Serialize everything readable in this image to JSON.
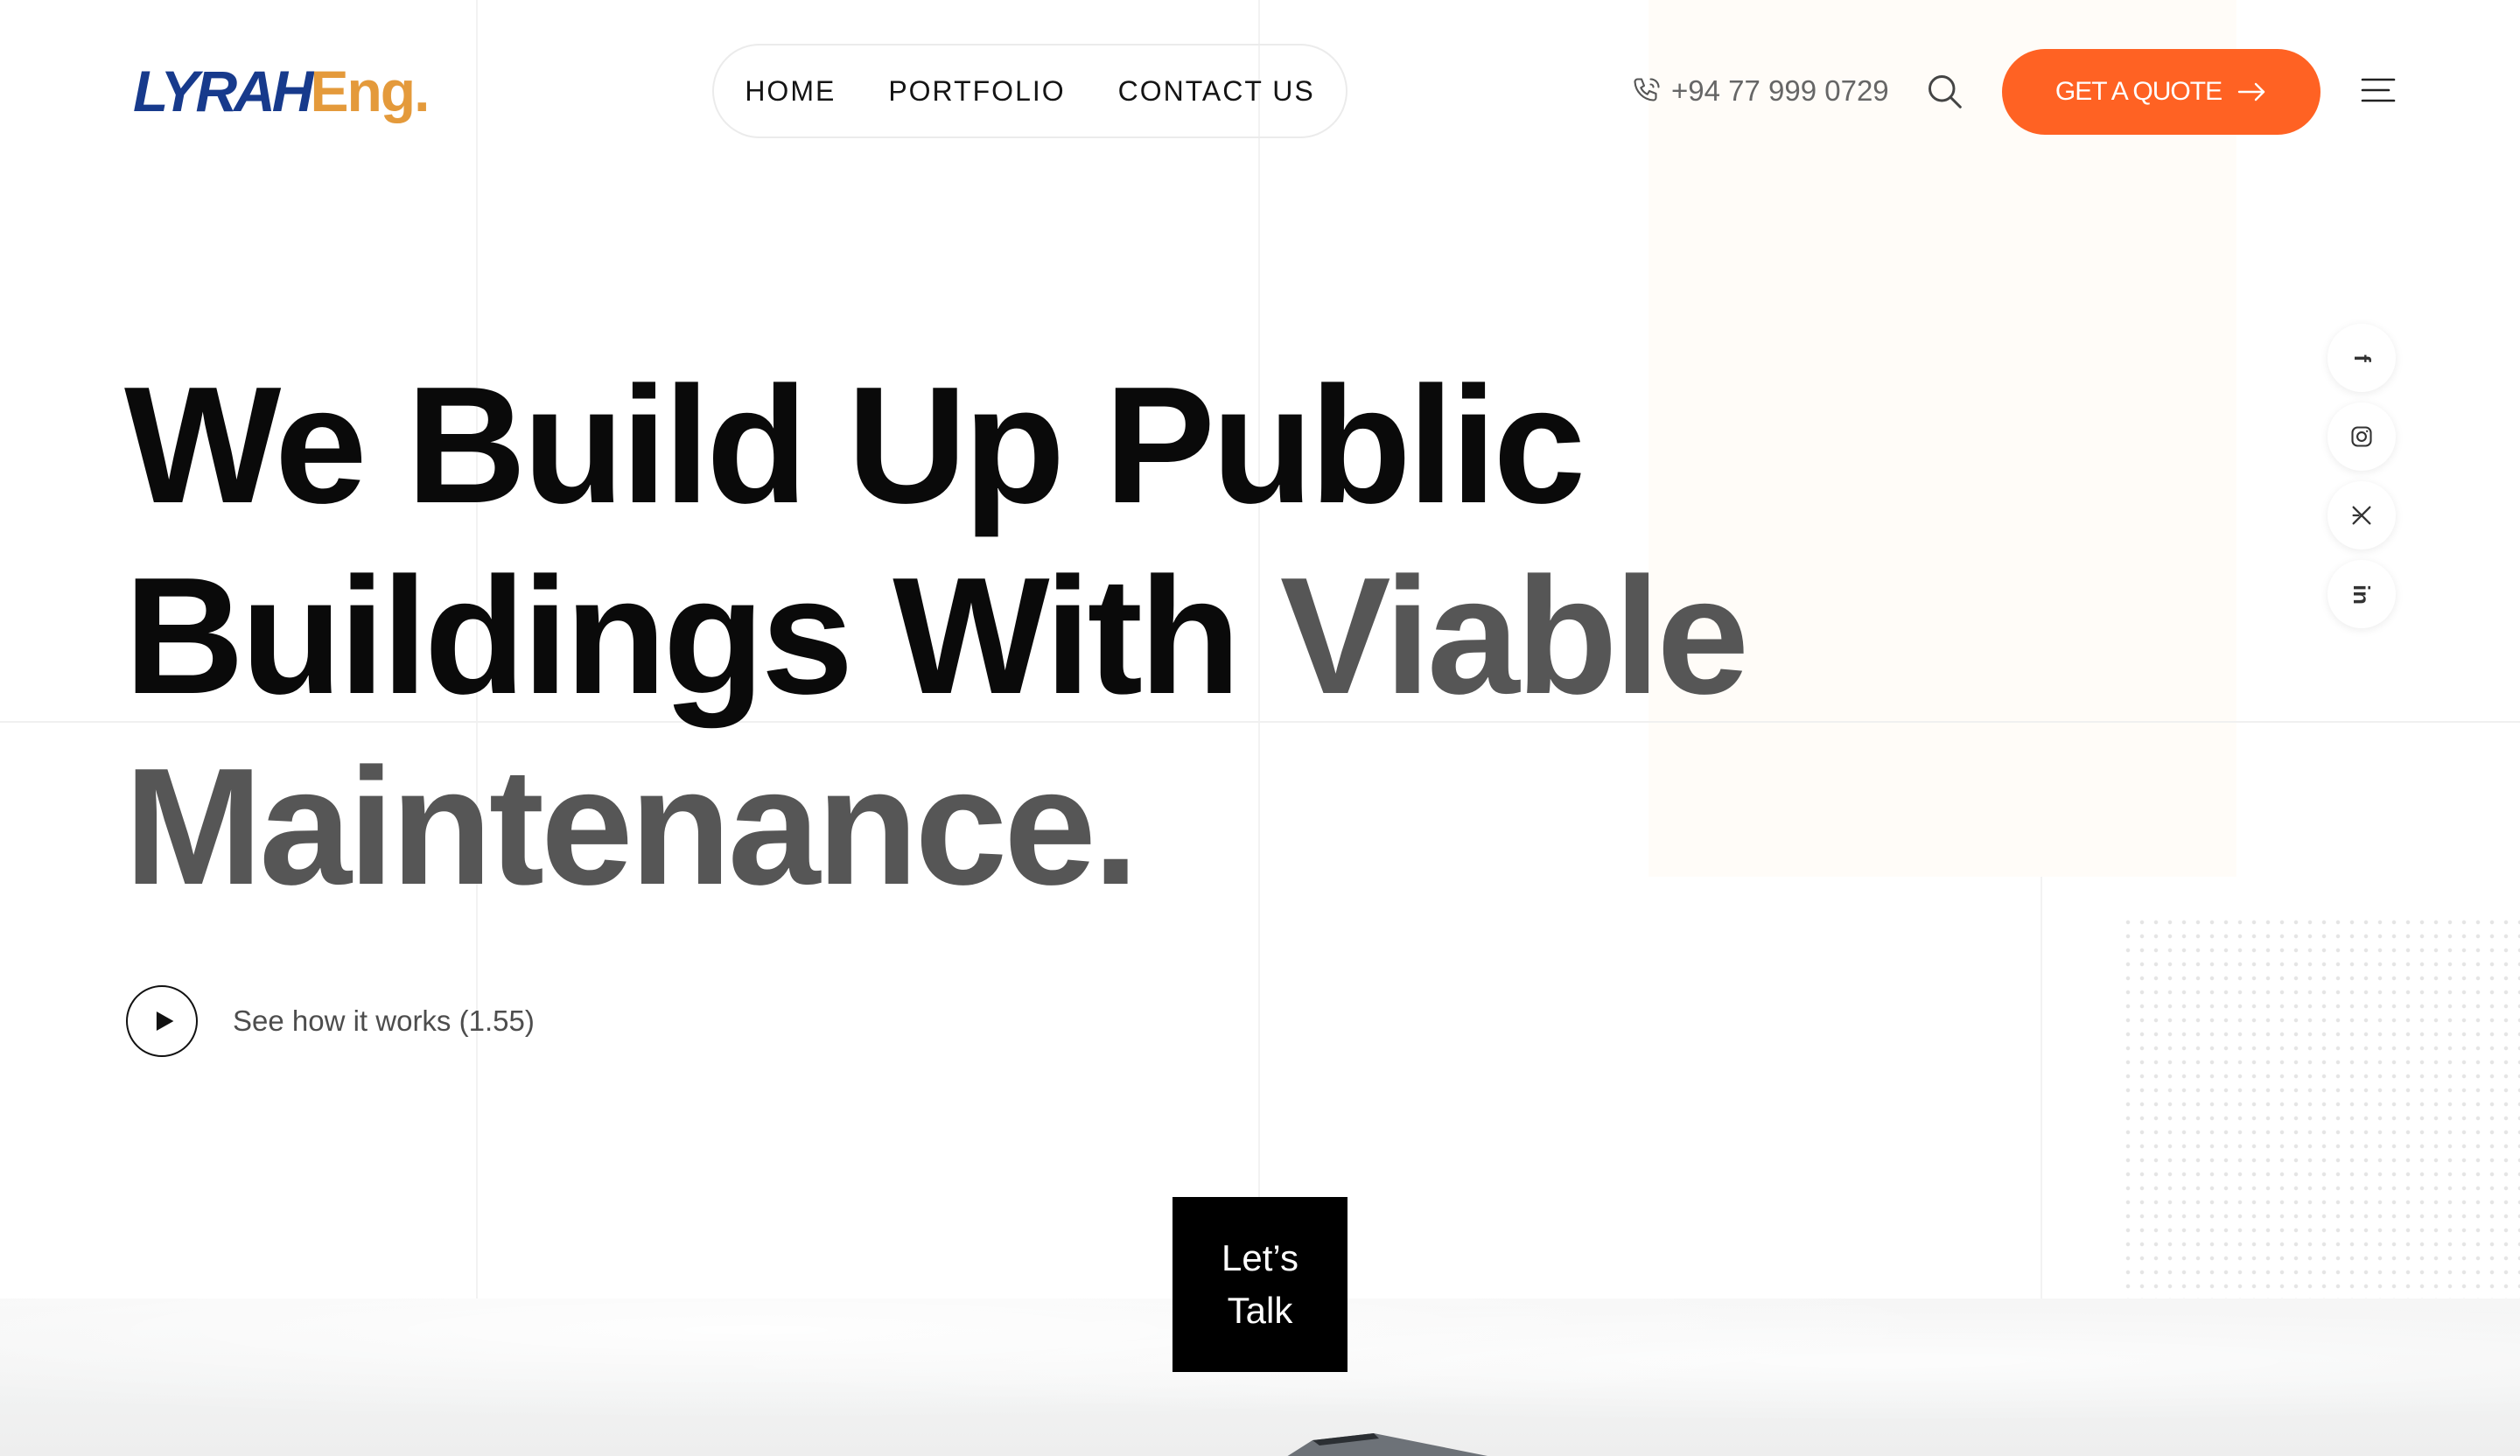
{
  "brand": {
    "logo_primary": "LYRAH",
    "logo_secondary": "Eng",
    "logo_dot": ".",
    "primary_color": "#173a8c",
    "secondary_color": "#e49a3b"
  },
  "nav": {
    "items": [
      {
        "label": "HOME"
      },
      {
        "label": "PORTFOLIO"
      },
      {
        "label": "CONTACT US"
      }
    ]
  },
  "header": {
    "phone": "+94 77 999 0729",
    "phone_icon": "phone-icon",
    "search_icon": "search-icon",
    "cta_label": "GET A QUOTE",
    "cta_icon": "arrow-right-icon",
    "cta_color": "#ff6223",
    "menu_icon": "hamburger-menu-icon"
  },
  "hero": {
    "line1": "We Build Up Public",
    "line2_dark": "Buildings With ",
    "line2_muted": "Viable",
    "line3": "Maintenance.",
    "play_icon": "play-icon",
    "play_label": "See how it works (1.55)"
  },
  "social": {
    "items": [
      {
        "icon": "facebook-icon",
        "glyph": "f"
      },
      {
        "icon": "instagram-icon"
      },
      {
        "icon": "x-icon"
      },
      {
        "icon": "linkedin-icon",
        "glyph": "in"
      }
    ]
  },
  "lets_talk": {
    "line1": "Let’s",
    "line2": "Talk"
  }
}
